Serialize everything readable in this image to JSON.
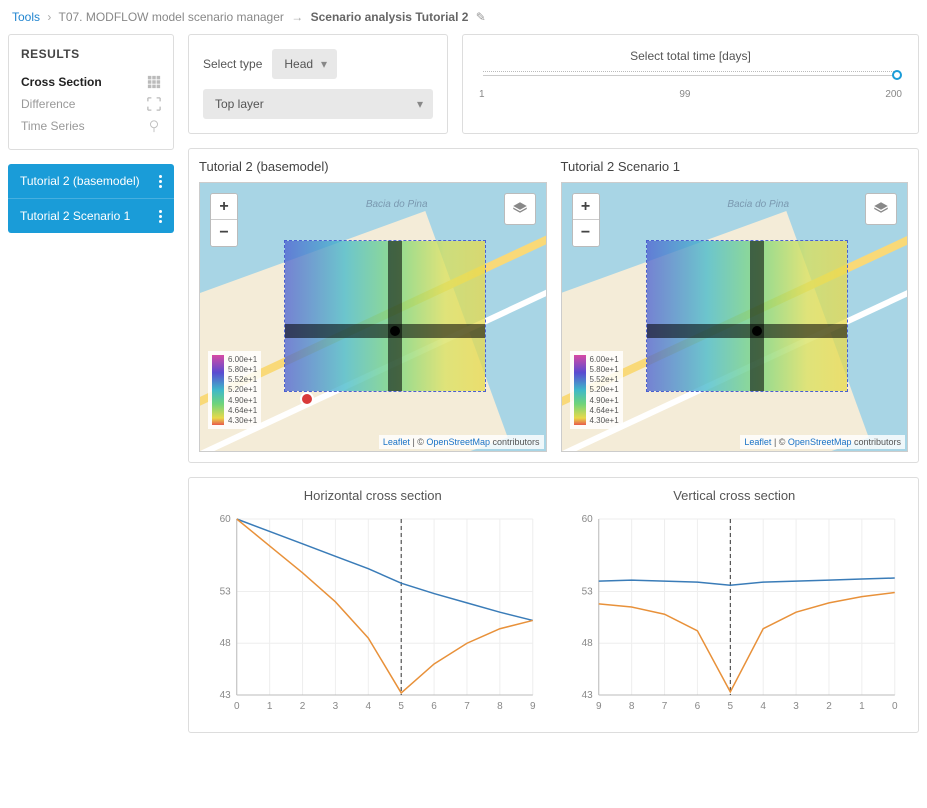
{
  "breadcrumb": {
    "tools": "Tools",
    "tool": "T07. MODFLOW model scenario manager",
    "current": "Scenario analysis Tutorial 2"
  },
  "results": {
    "title": "RESULTS",
    "items": [
      {
        "label": "Cross Section",
        "active": true
      },
      {
        "label": "Difference",
        "active": false
      },
      {
        "label": "Time Series",
        "active": false
      }
    ]
  },
  "scenarios": [
    {
      "label": "Tutorial 2 (basemodel)"
    },
    {
      "label": "Tutorial 2 Scenario 1"
    }
  ],
  "controls": {
    "select_type_label": "Select type",
    "select_type_value": "Head",
    "layer_value": "Top layer",
    "time_title": "Select total time [days]",
    "time_min": "1",
    "time_mid": "99",
    "time_max": "200"
  },
  "maps": [
    {
      "title": "Tutorial 2 (basemodel)",
      "bacia": "Bacia do Pina"
    },
    {
      "title": "Tutorial 2 Scenario 1",
      "bacia": "Bacia do Pina"
    }
  ],
  "legend_values": [
    "6.00e+1",
    "5.80e+1",
    "5.52e+1",
    "5.20e+1",
    "4.90e+1",
    "4.64e+1",
    "4.30e+1"
  ],
  "attribution": {
    "leaflet": "Leaflet",
    "sep": " | © ",
    "osm": "OpenStreetMap",
    "tail": " contributors"
  },
  "chart_data": [
    {
      "type": "line",
      "title": "Horizontal cross section",
      "xlabel": "",
      "ylabel": "",
      "x": [
        0,
        1,
        2,
        3,
        4,
        5,
        6,
        7,
        8,
        9
      ],
      "xlim": [
        0,
        9
      ],
      "ylim": [
        43,
        60
      ],
      "yticks": [
        43,
        48,
        53,
        60
      ],
      "marker_x": 5,
      "series": [
        {
          "name": "basemodel",
          "color": "#3a7cb8",
          "values": [
            60.0,
            58.8,
            57.6,
            56.4,
            55.2,
            53.8,
            52.8,
            51.9,
            51.0,
            50.2
          ]
        },
        {
          "name": "scenario1",
          "color": "#e8913a",
          "values": [
            60.0,
            57.4,
            54.8,
            52.0,
            48.5,
            43.2,
            46.0,
            48.0,
            49.4,
            50.2
          ]
        }
      ]
    },
    {
      "type": "line",
      "title": "Vertical cross section",
      "xlabel": "",
      "ylabel": "",
      "x": [
        9,
        8,
        7,
        6,
        5,
        4,
        3,
        2,
        1,
        0
      ],
      "xlim_reversed": true,
      "xlim": [
        9,
        0
      ],
      "ylim": [
        43,
        60
      ],
      "yticks": [
        43,
        48,
        53,
        60
      ],
      "marker_x": 5,
      "series": [
        {
          "name": "basemodel",
          "color": "#3a7cb8",
          "values": [
            54.0,
            54.1,
            54.0,
            53.9,
            53.6,
            53.9,
            54.0,
            54.1,
            54.2,
            54.3
          ]
        },
        {
          "name": "scenario1",
          "color": "#e8913a",
          "values": [
            51.8,
            51.5,
            50.8,
            49.2,
            43.3,
            49.4,
            51.0,
            51.9,
            52.5,
            52.9
          ]
        }
      ]
    }
  ]
}
